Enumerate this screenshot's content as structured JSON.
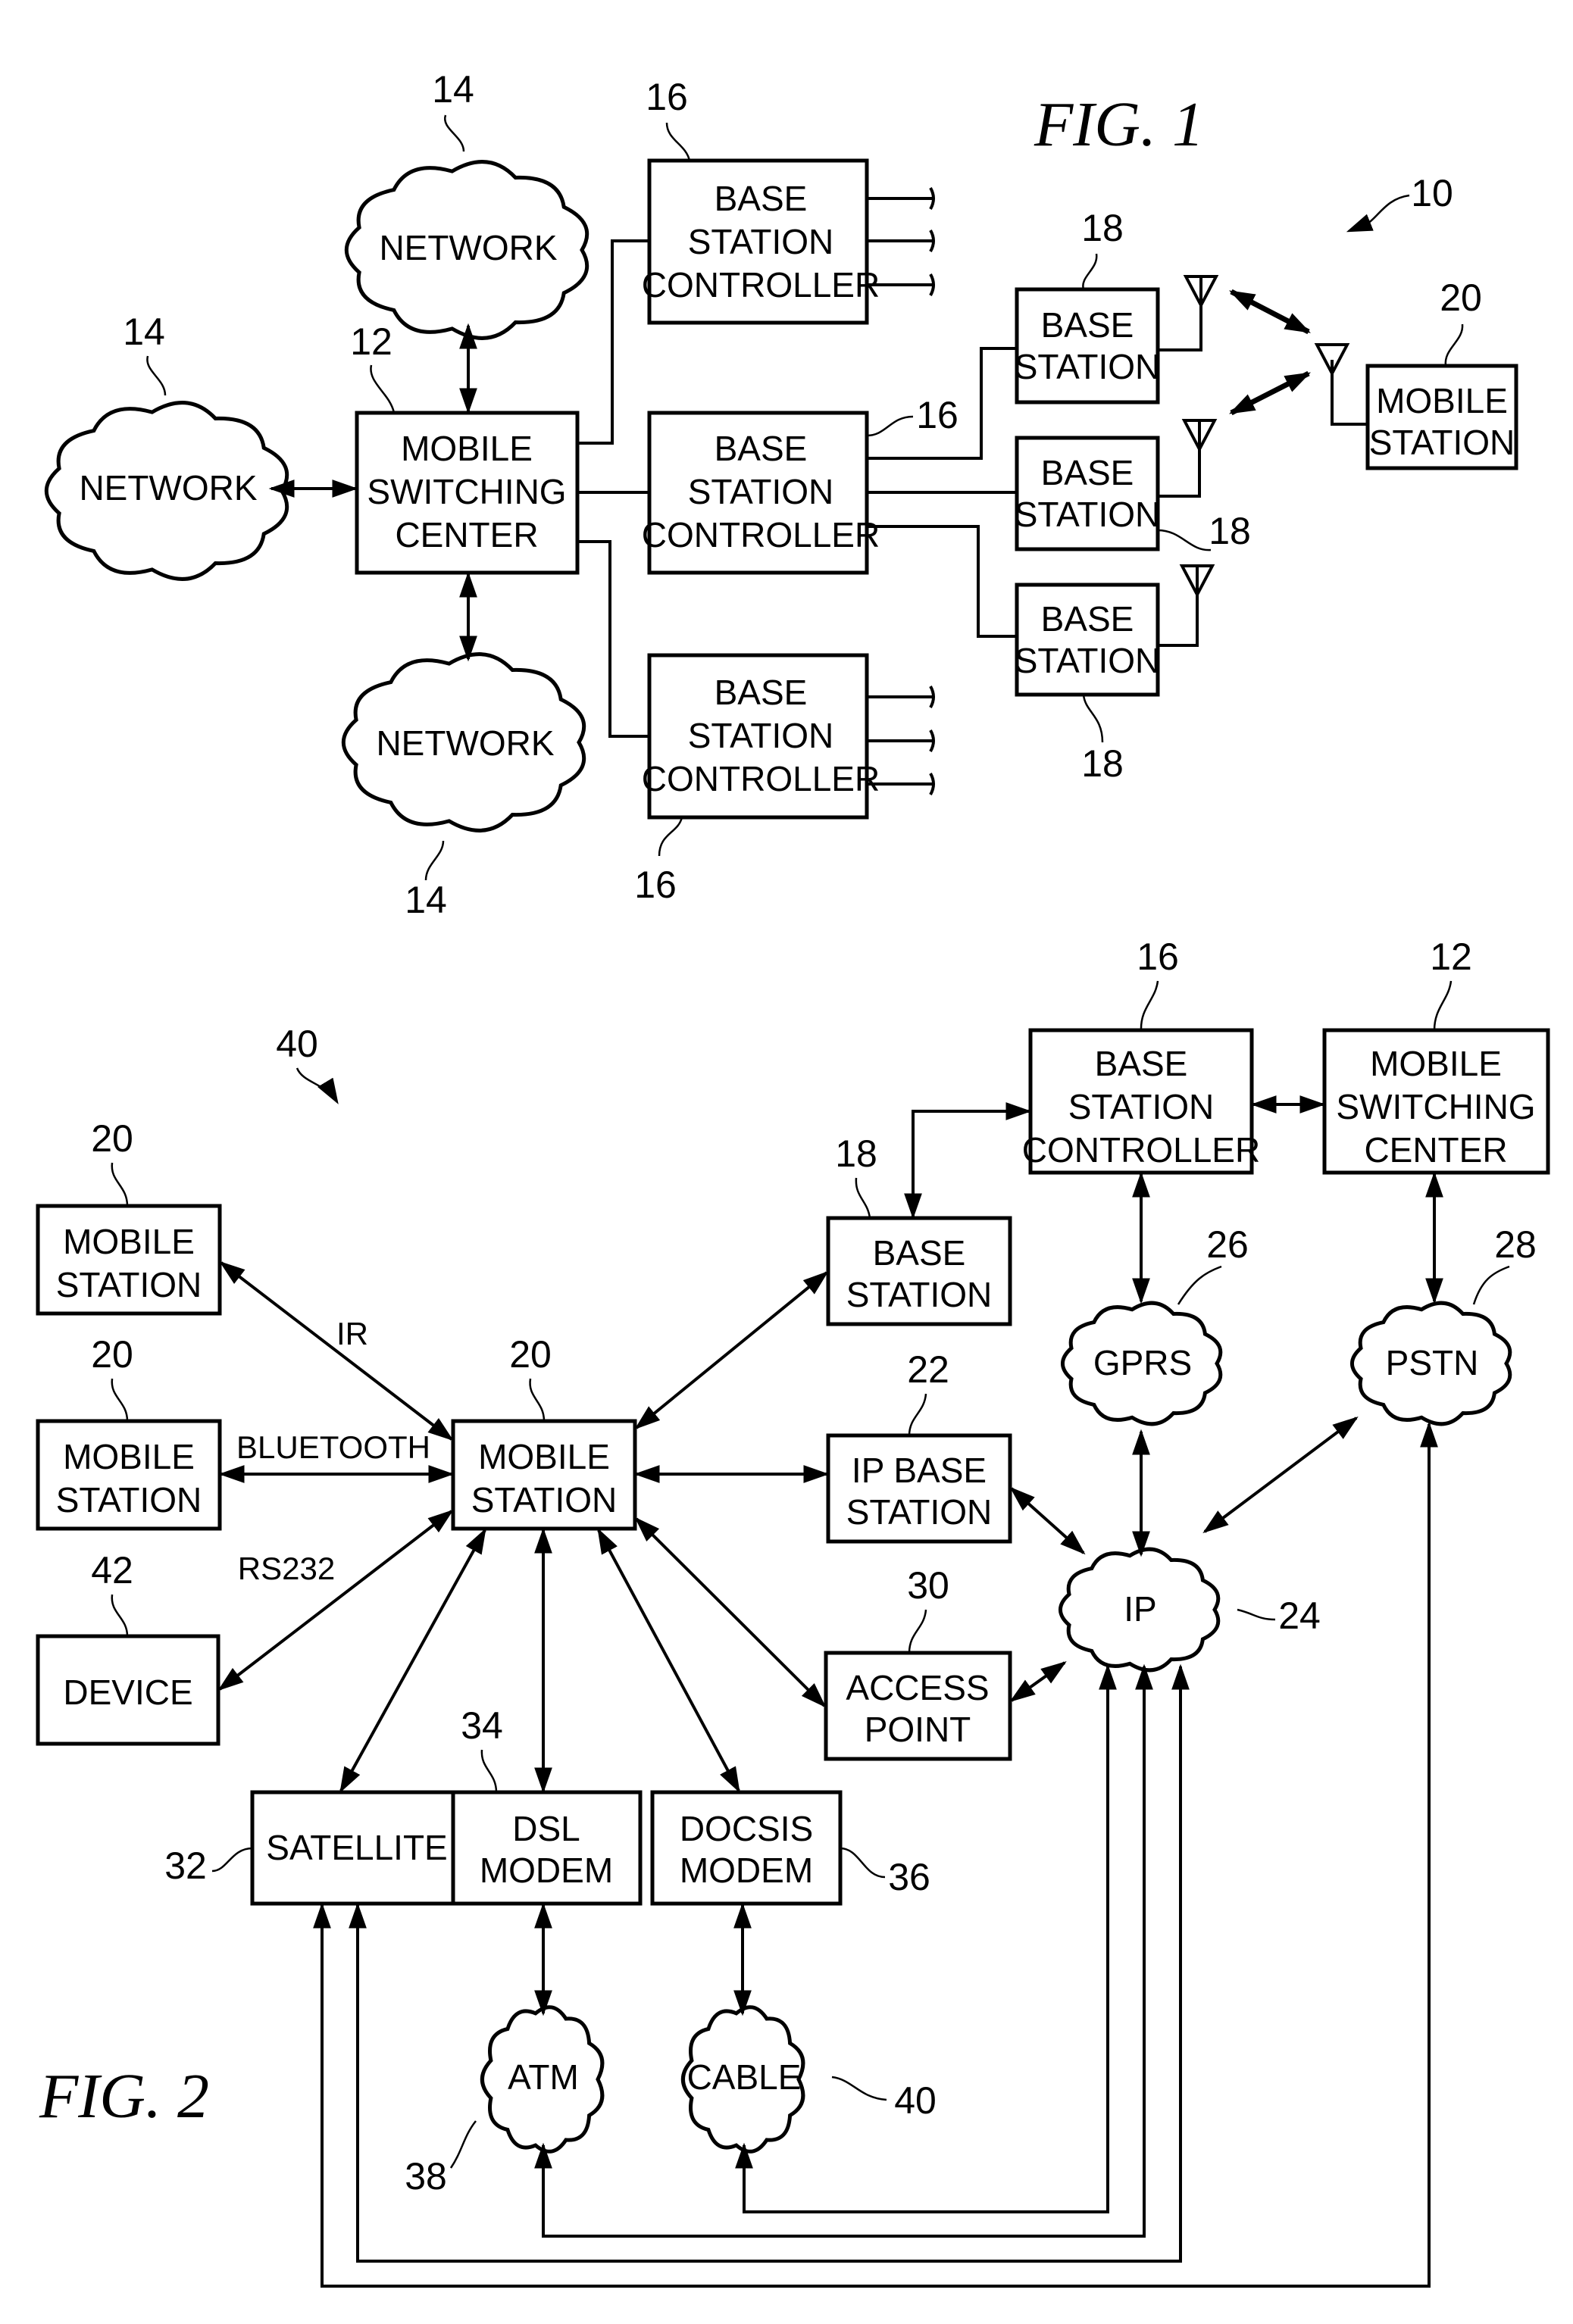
{
  "fig1": {
    "title": "FIG.  1",
    "system_ref": "10",
    "networks": [
      {
        "label": "NETWORK",
        "ref": "14"
      },
      {
        "label": "NETWORK",
        "ref": "14"
      },
      {
        "label": "NETWORK",
        "ref": "14"
      }
    ],
    "msc": {
      "lines": [
        "MOBILE",
        "SWITCHING",
        "CENTER"
      ],
      "ref": "12"
    },
    "bscs": [
      {
        "lines": [
          "BASE",
          "STATION",
          "CONTROLLER"
        ],
        "ref": "16"
      },
      {
        "lines": [
          "BASE",
          "STATION",
          "CONTROLLER"
        ],
        "ref": "16"
      },
      {
        "lines": [
          "BASE",
          "STATION",
          "CONTROLLER"
        ],
        "ref": "16"
      }
    ],
    "base_stations": [
      {
        "lines": [
          "BASE",
          "STATION"
        ],
        "ref": "18"
      },
      {
        "lines": [
          "BASE",
          "STATION"
        ],
        "ref": "18"
      },
      {
        "lines": [
          "BASE",
          "STATION"
        ],
        "ref": "18"
      }
    ],
    "mobile_station": {
      "lines": [
        "MOBILE",
        "STATION"
      ],
      "ref": "20"
    }
  },
  "fig2": {
    "title": "FIG.  2",
    "system_ref": "40",
    "mobile_station_1": {
      "lines": [
        "MOBILE",
        "STATION"
      ],
      "ref": "20"
    },
    "mobile_station_2": {
      "lines": [
        "MOBILE",
        "STATION"
      ],
      "ref": "20"
    },
    "device": {
      "lines": [
        "DEVICE"
      ],
      "ref": "42"
    },
    "center_mobile_station": {
      "lines": [
        "MOBILE",
        "STATION"
      ],
      "ref": "20"
    },
    "base_station": {
      "lines": [
        "BASE",
        "STATION"
      ],
      "ref": "18"
    },
    "ip_base_station": {
      "lines": [
        "IP  BASE",
        "STATION"
      ],
      "ref": "22"
    },
    "access_point": {
      "lines": [
        "ACCESS",
        "POINT"
      ],
      "ref": "30"
    },
    "bsc": {
      "lines": [
        "BASE",
        "STATION",
        "CONTROLLER"
      ],
      "ref": "16"
    },
    "msc": {
      "lines": [
        "MOBILE",
        "SWITCHING",
        "CENTER"
      ],
      "ref": "12"
    },
    "gprs": {
      "label": "GPRS",
      "ref": "26"
    },
    "pstn": {
      "label": "PSTN",
      "ref": "28"
    },
    "ip": {
      "label": "IP",
      "ref": "24"
    },
    "satellite": {
      "lines": [
        "SATELLITE"
      ],
      "ref": "32"
    },
    "dsl_modem": {
      "lines": [
        "DSL",
        "MODEM"
      ],
      "ref": "34"
    },
    "docsis_modem": {
      "lines": [
        "DOCSIS",
        "MODEM"
      ],
      "ref": "36"
    },
    "atm": {
      "label": "ATM",
      "ref": "38"
    },
    "cable": {
      "label": "CABLE",
      "ref": "40"
    },
    "links": {
      "ir": "IR",
      "bluetooth": "BLUETOOTH",
      "rs232": "RS232"
    }
  }
}
